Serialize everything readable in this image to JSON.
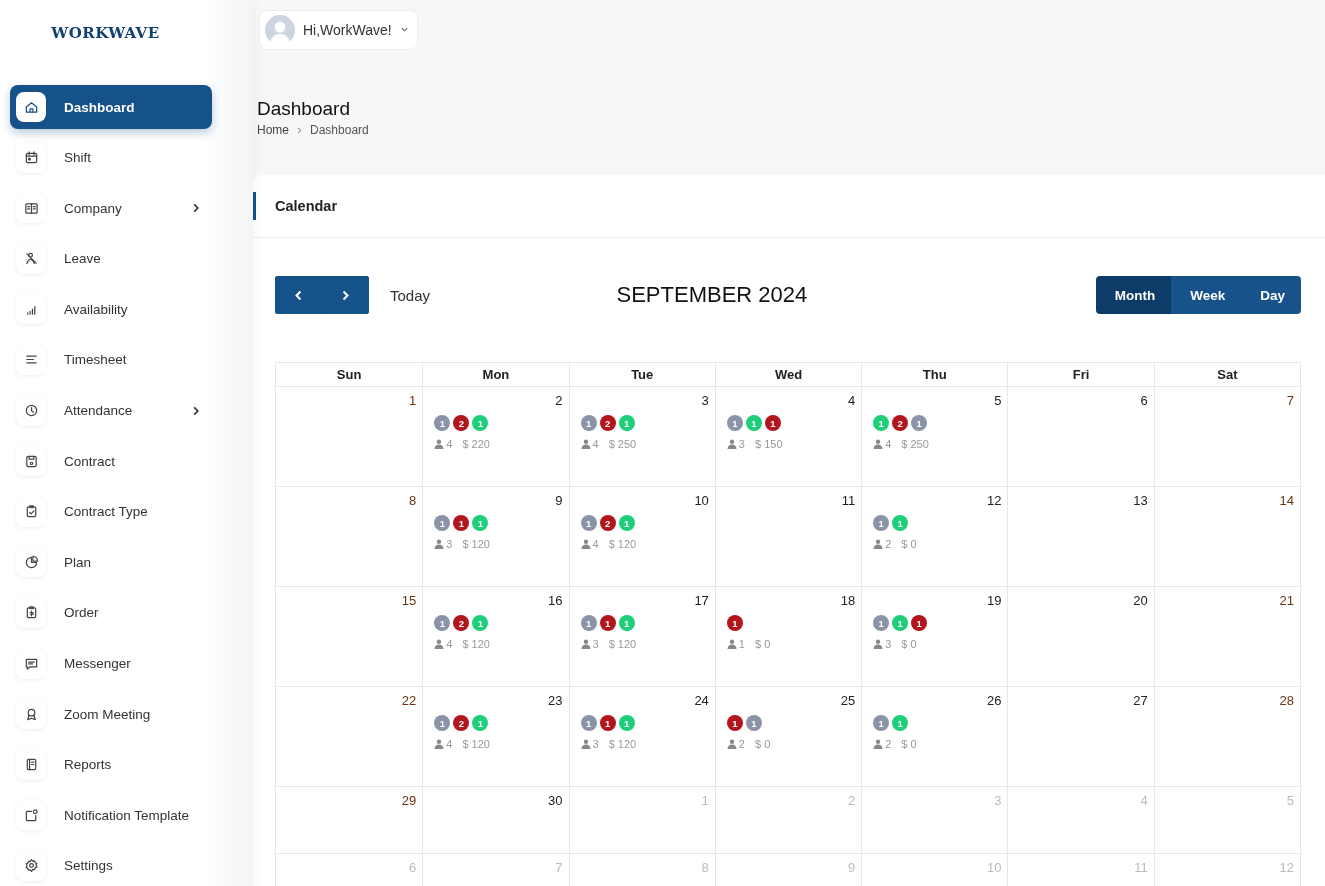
{
  "logo": {
    "text": "WORKWAVE"
  },
  "user": {
    "greeting": "Hi,WorkWave!"
  },
  "sidebar": {
    "items": [
      {
        "label": "Dashboard",
        "selected": true,
        "has_submenu": false
      },
      {
        "label": "Shift",
        "selected": false,
        "has_submenu": false
      },
      {
        "label": "Company",
        "selected": false,
        "has_submenu": true
      },
      {
        "label": "Leave",
        "selected": false,
        "has_submenu": false
      },
      {
        "label": "Availability",
        "selected": false,
        "has_submenu": false
      },
      {
        "label": "Timesheet",
        "selected": false,
        "has_submenu": false
      },
      {
        "label": "Attendance",
        "selected": false,
        "has_submenu": true
      },
      {
        "label": "Contract",
        "selected": false,
        "has_submenu": false
      },
      {
        "label": "Contract Type",
        "selected": false,
        "has_submenu": false
      },
      {
        "label": "Plan",
        "selected": false,
        "has_submenu": false
      },
      {
        "label": "Order",
        "selected": false,
        "has_submenu": false
      },
      {
        "label": "Messenger",
        "selected": false,
        "has_submenu": false
      },
      {
        "label": "Zoom Meeting",
        "selected": false,
        "has_submenu": false
      },
      {
        "label": "Reports",
        "selected": false,
        "has_submenu": false
      },
      {
        "label": "Notification Template",
        "selected": false,
        "has_submenu": false
      },
      {
        "label": "Settings",
        "selected": false,
        "has_submenu": false
      }
    ]
  },
  "page": {
    "title": "Dashboard",
    "breadcrumb": [
      "Home",
      "Dashboard"
    ]
  },
  "calendar": {
    "card_title": "Calendar",
    "today_label": "Today",
    "month_title": "SEPTEMBER 2024",
    "views": [
      {
        "label": "Month",
        "selected": true
      },
      {
        "label": "Week",
        "selected": false
      },
      {
        "label": "Day",
        "selected": false
      }
    ],
    "weekdays": [
      "Sun",
      "Mon",
      "Tue",
      "Wed",
      "Thu",
      "Fri",
      "Sat"
    ],
    "weeks": [
      {
        "days": [
          {
            "day": "1",
            "other_month": false
          },
          {
            "day": "2",
            "other_month": false,
            "badges": [
              {
                "count": "1",
                "color": "#8a94a6"
              },
              {
                "count": "2",
                "color": "#b3151c"
              },
              {
                "count": "1",
                "color": "#1ecf7a"
              }
            ],
            "staff": "4",
            "amount": "$ 220"
          },
          {
            "day": "3",
            "other_month": false,
            "badges": [
              {
                "count": "1",
                "color": "#8a94a6"
              },
              {
                "count": "2",
                "color": "#b3151c"
              },
              {
                "count": "1",
                "color": "#1ecf7a"
              }
            ],
            "staff": "4",
            "amount": "$ 250"
          },
          {
            "day": "4",
            "other_month": false,
            "badges": [
              {
                "count": "1",
                "color": "#8a94a6"
              },
              {
                "count": "1",
                "color": "#1ecf7a"
              },
              {
                "count": "1",
                "color": "#b3151c"
              }
            ],
            "staff": "3",
            "amount": "$ 150"
          },
          {
            "day": "5",
            "other_month": false,
            "badges": [
              {
                "count": "1",
                "color": "#1ecf7a"
              },
              {
                "count": "2",
                "color": "#b3151c"
              },
              {
                "count": "1",
                "color": "#8a94a6"
              }
            ],
            "staff": "4",
            "amount": "$ 250"
          },
          {
            "day": "6",
            "other_month": false
          },
          {
            "day": "7",
            "other_month": false
          }
        ]
      },
      {
        "days": [
          {
            "day": "8",
            "other_month": false
          },
          {
            "day": "9",
            "other_month": false,
            "badges": [
              {
                "count": "1",
                "color": "#8a94a6"
              },
              {
                "count": "1",
                "color": "#b3151c"
              },
              {
                "count": "1",
                "color": "#1ecf7a"
              }
            ],
            "staff": "3",
            "amount": "$ 120"
          },
          {
            "day": "10",
            "other_month": false,
            "badges": [
              {
                "count": "1",
                "color": "#8a94a6"
              },
              {
                "count": "2",
                "color": "#b3151c"
              },
              {
                "count": "1",
                "color": "#1ecf7a"
              }
            ],
            "staff": "4",
            "amount": "$ 120"
          },
          {
            "day": "11",
            "other_month": false
          },
          {
            "day": "12",
            "other_month": false,
            "badges": [
              {
                "count": "1",
                "color": "#8a94a6"
              },
              {
                "count": "1",
                "color": "#1ecf7a"
              }
            ],
            "staff": "2",
            "amount": "$ 0"
          },
          {
            "day": "13",
            "other_month": false
          },
          {
            "day": "14",
            "other_month": false
          }
        ]
      },
      {
        "days": [
          {
            "day": "15",
            "other_month": false
          },
          {
            "day": "16",
            "other_month": false,
            "badges": [
              {
                "count": "1",
                "color": "#8a94a6"
              },
              {
                "count": "2",
                "color": "#b3151c"
              },
              {
                "count": "1",
                "color": "#1ecf7a"
              }
            ],
            "staff": "4",
            "amount": "$ 120"
          },
          {
            "day": "17",
            "other_month": false,
            "badges": [
              {
                "count": "1",
                "color": "#8a94a6"
              },
              {
                "count": "1",
                "color": "#b3151c"
              },
              {
                "count": "1",
                "color": "#1ecf7a"
              }
            ],
            "staff": "3",
            "amount": "$ 120"
          },
          {
            "day": "18",
            "other_month": false,
            "badges": [
              {
                "count": "1",
                "color": "#b3151c"
              }
            ],
            "staff": "1",
            "amount": "$ 0"
          },
          {
            "day": "19",
            "other_month": false,
            "badges": [
              {
                "count": "1",
                "color": "#8a94a6"
              },
              {
                "count": "1",
                "color": "#1ecf7a"
              },
              {
                "count": "1",
                "color": "#b3151c"
              }
            ],
            "staff": "3",
            "amount": "$ 0"
          },
          {
            "day": "20",
            "other_month": false
          },
          {
            "day": "21",
            "other_month": false
          }
        ]
      },
      {
        "days": [
          {
            "day": "22",
            "other_month": false
          },
          {
            "day": "23",
            "other_month": false,
            "badges": [
              {
                "count": "1",
                "color": "#8a94a6"
              },
              {
                "count": "2",
                "color": "#b3151c"
              },
              {
                "count": "1",
                "color": "#1ecf7a"
              }
            ],
            "staff": "4",
            "amount": "$ 120"
          },
          {
            "day": "24",
            "other_month": false,
            "badges": [
              {
                "count": "1",
                "color": "#8a94a6"
              },
              {
                "count": "1",
                "color": "#b3151c"
              },
              {
                "count": "1",
                "color": "#1ecf7a"
              }
            ],
            "staff": "3",
            "amount": "$ 120"
          },
          {
            "day": "25",
            "other_month": false,
            "badges": [
              {
                "count": "1",
                "color": "#b3151c"
              },
              {
                "count": "1",
                "color": "#8a94a6"
              }
            ],
            "staff": "2",
            "amount": "$ 0"
          },
          {
            "day": "26",
            "other_month": false,
            "badges": [
              {
                "count": "1",
                "color": "#8a94a6"
              },
              {
                "count": "1",
                "color": "#1ecf7a"
              }
            ],
            "staff": "2",
            "amount": "$ 0"
          },
          {
            "day": "27",
            "other_month": false
          },
          {
            "day": "28",
            "other_month": false
          }
        ]
      },
      {
        "days": [
          {
            "day": "29",
            "other_month": false
          },
          {
            "day": "30",
            "other_month": false
          },
          {
            "day": "1",
            "other_month": true
          },
          {
            "day": "2",
            "other_month": true
          },
          {
            "day": "3",
            "other_month": true
          },
          {
            "day": "4",
            "other_month": true
          },
          {
            "day": "5",
            "other_month": true
          }
        ]
      },
      {
        "days": [
          {
            "day": "6",
            "other_month": true
          },
          {
            "day": "7",
            "other_month": true
          },
          {
            "day": "8",
            "other_month": true
          },
          {
            "day": "9",
            "other_month": true
          },
          {
            "day": "10",
            "other_month": true
          },
          {
            "day": "11",
            "other_month": true
          },
          {
            "day": "12",
            "other_month": true
          }
        ]
      }
    ]
  }
}
